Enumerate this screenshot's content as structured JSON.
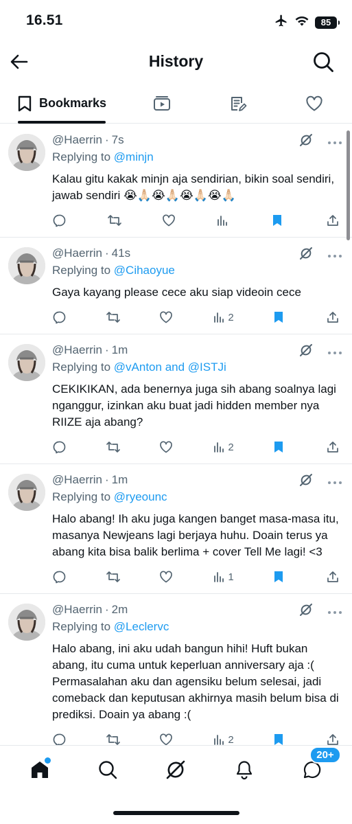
{
  "status_bar": {
    "time": "16.51",
    "battery": "85"
  },
  "header": {
    "title": "History",
    "back_icon": "arrow-left-icon",
    "search_icon": "search-icon"
  },
  "tabs": [
    {
      "label": "Bookmarks",
      "icon": "bookmark-icon",
      "active": true
    },
    {
      "label": "",
      "icon": "video-icon",
      "active": false
    },
    {
      "label": "",
      "icon": "article-icon",
      "active": false
    },
    {
      "label": "",
      "icon": "heart-icon",
      "active": false
    }
  ],
  "tweets": [
    {
      "handle": "@Haerrin",
      "time": "7s",
      "reply_prefix": "Replying to ",
      "reply_to": "@minjn",
      "text": "Kalau gitu kakak minjn aja sendirian, bikin soal sendiri, jawab sendiri 😭🙏🏻😭🙏🏻😭🙏🏻😭🙏🏻",
      "views": ""
    },
    {
      "handle": "@Haerrin",
      "time": "41s",
      "reply_prefix": "Replying to ",
      "reply_to": "@Cihaoyue",
      "text": "Gaya kayang please cece aku siap videoin cece",
      "views": "2"
    },
    {
      "handle": "@Haerrin",
      "time": "1m",
      "reply_prefix": "Replying to ",
      "reply_to": "@vAnton and @ISTJi",
      "text": "CEKIKIKAN, ada benernya juga sih abang soalnya lagi nganggur, izinkan aku buat jadi hidden member nya RIIZE aja abang?",
      "views": "2"
    },
    {
      "handle": "@Haerrin",
      "time": "1m",
      "reply_prefix": "Replying to ",
      "reply_to": "@ryeounc",
      "text": "Halo abang! Ih aku juga kangen banget masa-masa itu, masanya Newjeans lagi berjaya huhu. Doain terus ya abang kita bisa balik berlima + cover Tell Me lagi! <3",
      "views": "1"
    },
    {
      "handle": "@Haerrin",
      "time": "2m",
      "reply_prefix": "Replying to ",
      "reply_to": "@Leclervc",
      "text": "Halo abang, ini aku udah bangun hihi! Huft bukan abang, itu cuma untuk keperluan anniversary aja :( Permasalahan aku dan agensiku belum selesai, jadi comeback dan keputusan akhirnya masih belum bisa di prediksi. Doain ya abang :(",
      "views": "2"
    }
  ],
  "bottom_nav": {
    "items": [
      "home-icon",
      "search-icon",
      "grok-icon",
      "bell-icon",
      "messages-icon"
    ],
    "messages_badge": "20+"
  },
  "colors": {
    "accent": "#1d9bf0",
    "text": "#0f1419",
    "muted": "#536471"
  }
}
